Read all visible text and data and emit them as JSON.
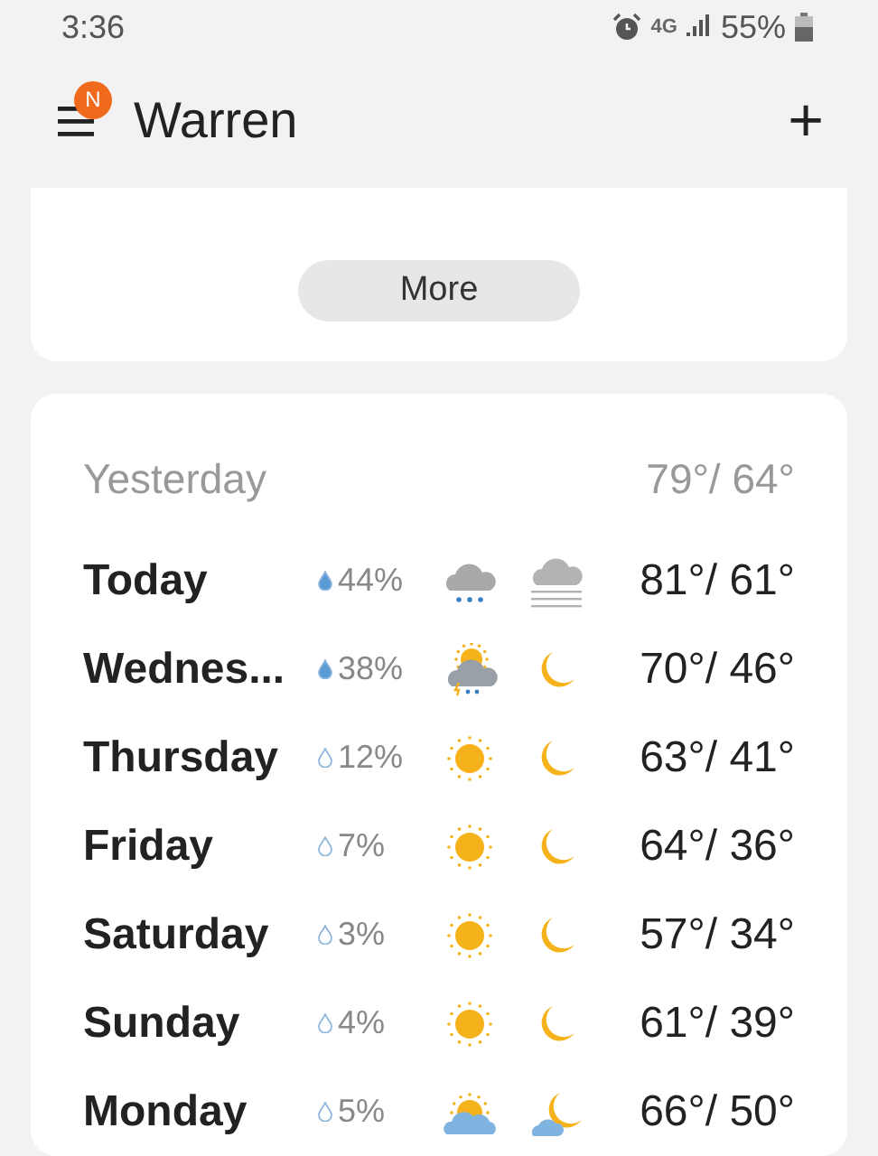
{
  "status_bar": {
    "time": "3:36",
    "network": "4G",
    "battery": "55%"
  },
  "header": {
    "badge": "N",
    "title": "Warren",
    "add": "+"
  },
  "more_button": "More",
  "yesterday": {
    "label": "Yesterday",
    "temps": "79°/ 64°"
  },
  "days": [
    {
      "name": "Today",
      "rain": "44%",
      "drop_filled": true,
      "day_icon": {
        "kind": "rain"
      },
      "night_icon": {
        "kind": "fog"
      },
      "temps": "81°/ 61°"
    },
    {
      "name": "Wednes...",
      "rain": "38%",
      "drop_filled": true,
      "day_icon": {
        "kind": "storm"
      },
      "night_icon": {
        "kind": "moon"
      },
      "temps": "70°/ 46°"
    },
    {
      "name": "Thursday",
      "rain": "12%",
      "drop_filled": false,
      "day_icon": {
        "kind": "sun"
      },
      "night_icon": {
        "kind": "moon"
      },
      "temps": "63°/ 41°"
    },
    {
      "name": "Friday",
      "rain": "7%",
      "drop_filled": false,
      "day_icon": {
        "kind": "sun"
      },
      "night_icon": {
        "kind": "moon"
      },
      "temps": "64°/ 36°"
    },
    {
      "name": "Saturday",
      "rain": "3%",
      "drop_filled": false,
      "day_icon": {
        "kind": "sun"
      },
      "night_icon": {
        "kind": "moon"
      },
      "temps": "57°/ 34°"
    },
    {
      "name": "Sunday",
      "rain": "4%",
      "drop_filled": false,
      "day_icon": {
        "kind": "sun"
      },
      "night_icon": {
        "kind": "moon"
      },
      "temps": "61°/ 39°"
    },
    {
      "name": "Monday",
      "rain": "5%",
      "drop_filled": false,
      "day_icon": {
        "kind": "partly"
      },
      "night_icon": {
        "kind": "partly-night"
      },
      "temps": "66°/ 50°"
    }
  ]
}
